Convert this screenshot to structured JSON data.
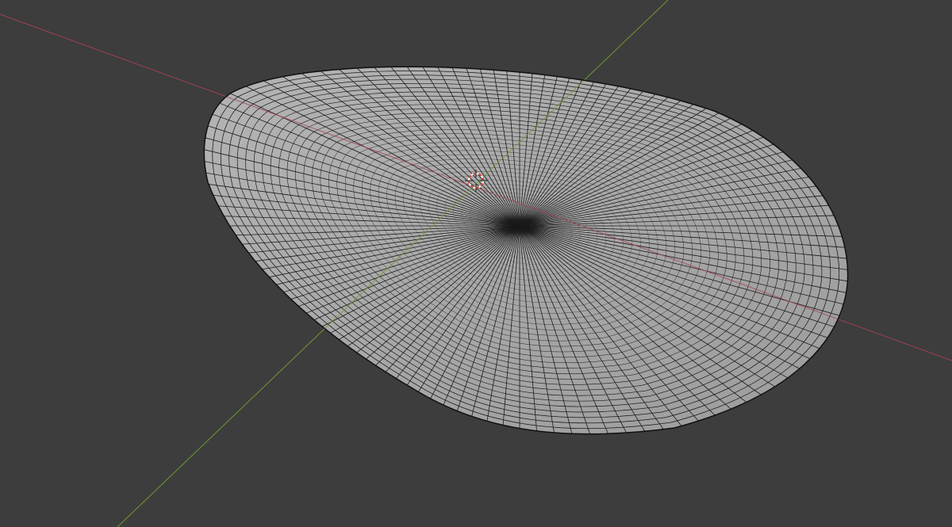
{
  "viewport": {
    "background_color": "#3d3d3d",
    "mesh_fill_color": "#ababab",
    "mesh_wire_color": "#1a1a1a",
    "x_axis_color": "#a3404e",
    "y_axis_color": "#6e9a2e",
    "ring_count": 38,
    "radial_count": 120
  }
}
